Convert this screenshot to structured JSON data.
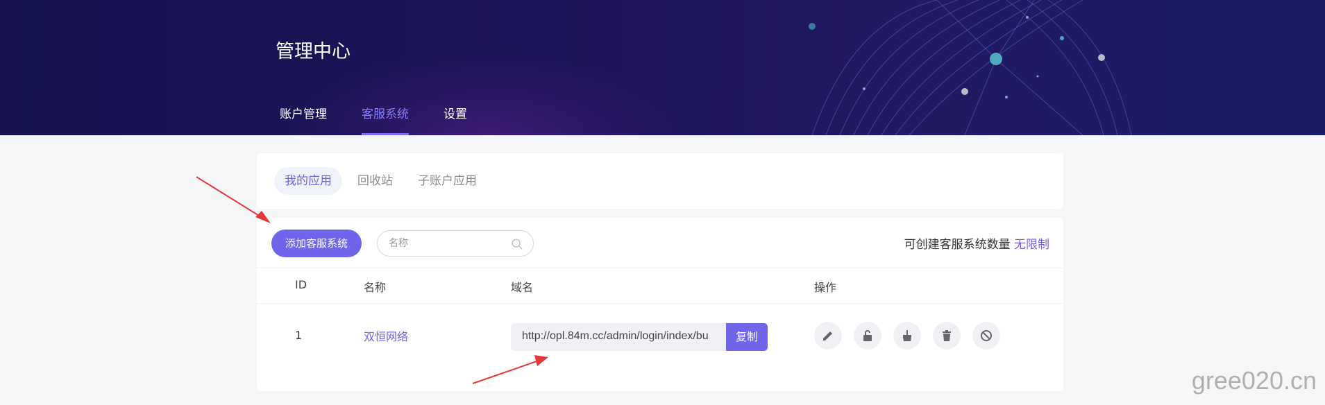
{
  "header": {
    "title": "管理中心",
    "nav": [
      {
        "label": "账户管理",
        "active": false
      },
      {
        "label": "客服系统",
        "active": true
      },
      {
        "label": "设置",
        "active": false
      }
    ]
  },
  "subtabs": [
    {
      "label": "我的应用",
      "active": true
    },
    {
      "label": "回收站",
      "active": false
    },
    {
      "label": "子账户应用",
      "active": false
    }
  ],
  "toolbar": {
    "add_label": "添加客服系统",
    "search_placeholder": "名称",
    "quota_label": "可创建客服系统数量",
    "quota_value": "无限制"
  },
  "table": {
    "columns": [
      "ID",
      "名称",
      "域名",
      "操作"
    ],
    "rows": [
      {
        "id": "1",
        "name": "双恒网络",
        "domain": "http://opl.84m.cc/admin/login/index/bu",
        "copy_label": "复制",
        "actions": [
          "edit-icon",
          "unlock-icon",
          "clean-icon",
          "trash-icon",
          "ban-icon"
        ]
      }
    ]
  },
  "watermark": "gree020.cn",
  "colors": {
    "accent": "#7065ea",
    "banner": "#1d1459",
    "annotation_arrow": "#e53935"
  }
}
